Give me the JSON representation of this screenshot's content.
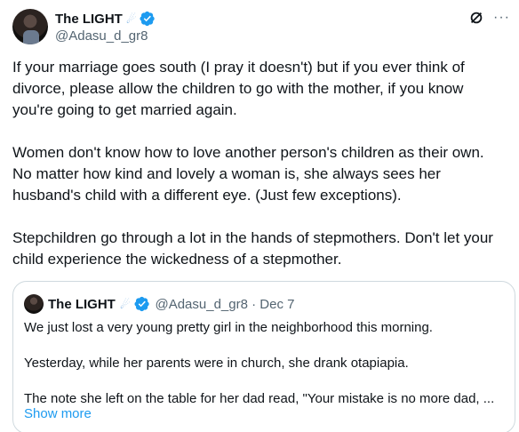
{
  "author": {
    "display_name": "The LIGHT",
    "handle": "@Adasu_d_gr8",
    "verified": true
  },
  "actions": {
    "grok_icon": "slash-circle-icon",
    "more_label": "···"
  },
  "post": {
    "paragraphs": [
      "If your marriage goes south (I pray it doesn't) but if you ever think of\ndivorce, please allow the children to go with the mother, if you know\nyou're going to get married again.",
      "Women don't know how to love another person's children as their own.\nNo matter how kind and lovely a woman is, she always sees her\nhusband's child with a different eye. (Just few exceptions).",
      "Stepchildren go through a lot in the hands of stepmothers. Don't let your\nchild experience the wickedness of a stepmother."
    ]
  },
  "quote": {
    "display_name": "The LIGHT",
    "handle_date": "@Adasu_d_gr8 · Dec 7",
    "paragraphs": [
      "We just lost a very young pretty girl in the neighborhood this morning.",
      "Yesterday, while her parents were in church, she drank otapiapia.",
      "The note she left on the table for her dad read, \"Your mistake is no more dad, ..."
    ],
    "show_more": "Show more"
  },
  "colors": {
    "text": "#0f1419",
    "muted": "#536471",
    "link": "#1d9bf0",
    "verified": "#1d9bf0",
    "border": "#cfd9de"
  }
}
